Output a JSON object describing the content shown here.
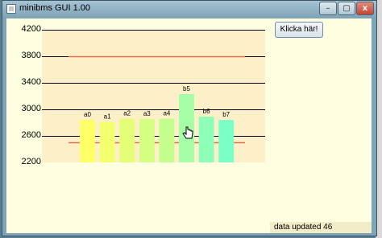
{
  "window": {
    "title": "minibms GUI 1.00"
  },
  "controls": {
    "minimize": "–",
    "maximize": "▢",
    "close": "x"
  },
  "button": {
    "label": "Klicka här!"
  },
  "status": {
    "text": "data updated 46"
  },
  "chart_data": {
    "type": "bar",
    "categories": [
      "a0",
      "a1",
      "a2",
      "a3",
      "a4",
      "b5",
      "b6",
      "b7"
    ],
    "values": [
      2840,
      2810,
      2860,
      2855,
      2860,
      3230,
      2890,
      2840
    ],
    "title": "",
    "xlabel": "",
    "ylabel": "",
    "ylim": [
      2200,
      4200
    ],
    "yticks": [
      4200,
      3800,
      3400,
      3000,
      2600,
      2200
    ],
    "reference_lines": [
      3800,
      2500
    ],
    "grid": true,
    "colors": [
      "#ffff66",
      "#f4ff6e",
      "#e4ff76",
      "#d4ff82",
      "#c4ff8e",
      "#a4ffa6",
      "#8effb8",
      "#7affc6"
    ],
    "reference_color": "#e07050"
  }
}
